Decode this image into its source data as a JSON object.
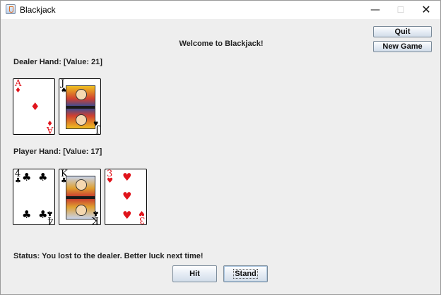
{
  "window": {
    "title": "Blackjack",
    "controls": {
      "minimize": "—",
      "maximize": "☐",
      "close": "✕"
    }
  },
  "buttons": {
    "quit": "Quit",
    "new_game": "New Game",
    "hit": "Hit",
    "stand": "Stand"
  },
  "welcome": "Welcome to Blackjack!",
  "dealer": {
    "label": "Dealer Hand: [Value: 21]",
    "cards": [
      {
        "rank": "A",
        "suit": "♦",
        "color": "red"
      },
      {
        "rank": "J",
        "suit": "♠",
        "color": "black"
      }
    ]
  },
  "player": {
    "label": "Player Hand: [Value: 17]",
    "cards": [
      {
        "rank": "4",
        "suit": "♣",
        "color": "black"
      },
      {
        "rank": "K",
        "suit": "♣",
        "color": "black"
      },
      {
        "rank": "3",
        "suit": "♥",
        "color": "red"
      }
    ]
  },
  "status": "Status: You lost to the dealer. Better luck next time!",
  "colors": {
    "red_suit": "#e0141c",
    "background": "#eeeeee"
  }
}
